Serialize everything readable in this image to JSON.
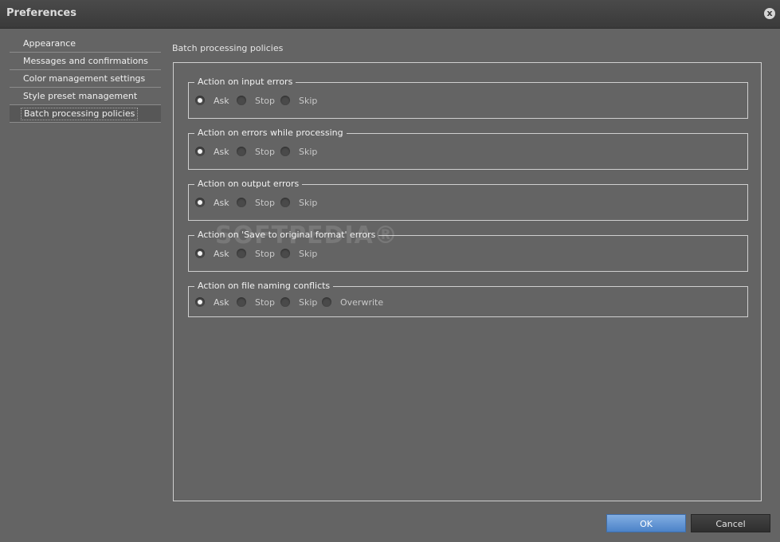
{
  "window": {
    "title": "Preferences",
    "close_icon": "close-icon",
    "close_glyph": "x"
  },
  "sidebar": {
    "items": [
      {
        "label": "Appearance",
        "selected": false
      },
      {
        "label": "Messages and confirmations",
        "selected": false
      },
      {
        "label": "Color management settings",
        "selected": false
      },
      {
        "label": "Style preset management",
        "selected": false
      },
      {
        "label": "Batch processing policies",
        "selected": true
      }
    ]
  },
  "main": {
    "section_title": "Batch processing policies",
    "groups": [
      {
        "legend": "Action on input errors",
        "options": [
          "Ask",
          "Stop",
          "Skip"
        ],
        "selected": "Ask"
      },
      {
        "legend": "Action on errors while processing",
        "options": [
          "Ask",
          "Stop",
          "Skip"
        ],
        "selected": "Ask"
      },
      {
        "legend": "Action on output errors",
        "options": [
          "Ask",
          "Stop",
          "Skip"
        ],
        "selected": "Ask"
      },
      {
        "legend": "Action on 'Save to original format' errors",
        "options": [
          "Ask",
          "Stop",
          "Skip"
        ],
        "selected": "Ask"
      },
      {
        "legend": "Action on file naming conflicts",
        "options": [
          "Ask",
          "Stop",
          "Skip",
          "Overwrite"
        ],
        "selected": "Ask"
      }
    ]
  },
  "watermark": "SOFTPEDIA®",
  "footer": {
    "ok_label": "OK",
    "cancel_label": "Cancel"
  },
  "colors": {
    "background": "#646464",
    "titlebar": "#3a3a3a",
    "ok_button": "#4c83c8",
    "cancel_button": "#2f2f2f"
  }
}
